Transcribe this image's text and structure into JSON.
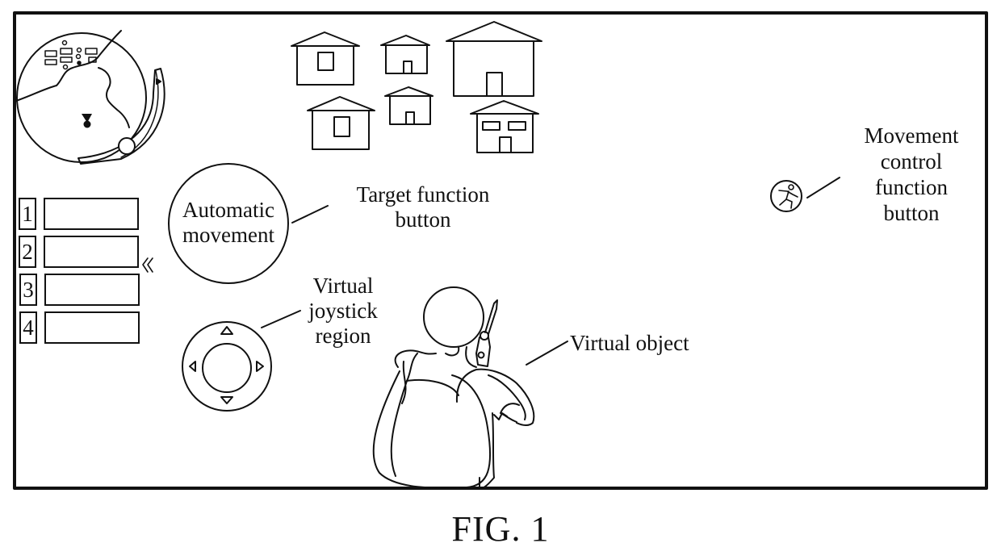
{
  "figure": {
    "caption": "FIG. 1"
  },
  "game_ui": {
    "minimap": {
      "icon": "minimap-icon",
      "player_marker_icon": "player-marker-icon"
    },
    "skill_slots": [
      {
        "number": "1"
      },
      {
        "number": "2"
      },
      {
        "number": "3"
      },
      {
        "number": "4"
      }
    ],
    "collapse_arrow_glyph": "«",
    "automatic_movement_button": {
      "line1": "Automatic",
      "line2": "movement"
    },
    "joystick": {
      "icon": "virtual-joystick-icon"
    },
    "movement_control_button": {
      "icon": "running-man-icon"
    },
    "houses_count": 6
  },
  "annotations": {
    "target_function_button": {
      "line1": "Target function",
      "line2": "button"
    },
    "virtual_joystick_region": {
      "line1": "Virtual",
      "line2": "joystick",
      "line3": "region"
    },
    "virtual_object": {
      "line1": "Virtual object"
    },
    "movement_control_function_button": {
      "line1": "Movement",
      "line2": "control",
      "line3": "function",
      "line4": "button"
    }
  }
}
